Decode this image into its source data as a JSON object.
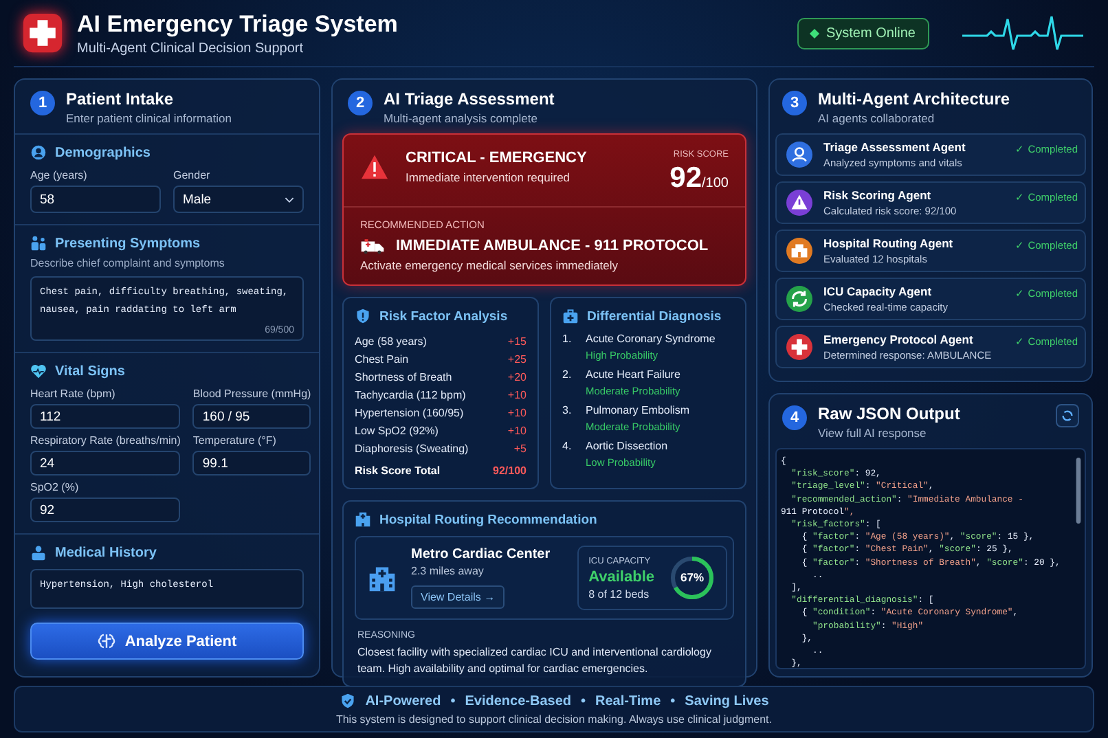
{
  "header": {
    "title": "AI Emergency Triage System",
    "subtitle": "Multi-Agent Clinical Decision Support",
    "status": "System Online"
  },
  "intake": {
    "number": "1",
    "title": "Patient Intake",
    "subtitle": "Enter patient clinical information",
    "demographics": {
      "title": "Demographics",
      "age_label": "Age (years)",
      "age": "58",
      "gender_label": "Gender",
      "gender": "Male"
    },
    "symptoms": {
      "title": "Presenting Symptoms",
      "hint": "Describe chief complaint and symptoms",
      "text": "Chest pain, difficulty breathing, sweating, nausea, pain raddating to left arm",
      "counter": "69/500"
    },
    "vitals": {
      "title": "Vital Signs",
      "fields": [
        {
          "label": "Heart Rate (bpm)",
          "value": "112"
        },
        {
          "label": "Blood Pressure (mmHg)",
          "value": "160 / 95"
        },
        {
          "label": "Respiratory Rate (breaths/min)",
          "value": "24"
        },
        {
          "label": "Temperature (°F)",
          "value": "99.1"
        },
        {
          "label": "SpO2 (%)",
          "value": "92"
        }
      ]
    },
    "history": {
      "title": "Medical History",
      "text": "Hypertension, High cholesterol"
    },
    "button": "Analyze Patient"
  },
  "assessment": {
    "number": "2",
    "title": "AI Triage Assessment",
    "subtitle": "Multi-agent analysis complete",
    "level": "CRITICAL - EMERGENCY",
    "level_note": "Immediate intervention required",
    "risk_label": "RISK SCORE",
    "risk_score": "92",
    "risk_max": "/100",
    "action_label": "RECOMMENDED ACTION",
    "action": "IMMEDIATE AMBULANCE - 911 PROTOCOL",
    "action_note": "Activate emergency medical services immediately",
    "risk_factors": {
      "title": "Risk Factor Analysis",
      "rows": [
        {
          "factor": "Age (58 years)",
          "score": "+15"
        },
        {
          "factor": "Chest Pain",
          "score": "+25"
        },
        {
          "factor": "Shortness of Breath",
          "score": "+20"
        },
        {
          "factor": "Tachycardia (112 bpm)",
          "score": "+10"
        },
        {
          "factor": "Hypertension (160/95)",
          "score": "+10"
        },
        {
          "factor": "Low SpO2 (92%)",
          "score": "+10"
        },
        {
          "factor": "Diaphoresis (Sweating)",
          "score": "+5"
        }
      ],
      "total_label": "Risk Score Total",
      "total": "92/100"
    },
    "diagnosis": {
      "title": "Differential Diagnosis",
      "items": [
        {
          "number": "1.",
          "condition": "Acute Coronary Syndrome",
          "probability": "High Probability"
        },
        {
          "number": "2.",
          "condition": "Acute Heart Failure",
          "probability": "Moderate Probability"
        },
        {
          "number": "3.",
          "condition": "Pulmonary Embolism",
          "probability": "Moderate Probability"
        },
        {
          "number": "4.",
          "condition": "Aortic Dissection",
          "probability": "Low Probability"
        }
      ]
    },
    "routing": {
      "title": "Hospital Routing Recommendation",
      "hospital": "Metro Cardiac Center",
      "distance": "2.3 miles away",
      "details_button": "View Details →",
      "icu_label": "ICU CAPACITY",
      "icu_status": "Available",
      "beds": "8 of 12 beds",
      "level": 0.67,
      "percent": "67%",
      "reasoning_label": "REASONING",
      "reasoning": "Closest facility with specialized cardiac ICU and interventional cardiology team. High availability and optimal for cardiac emergencies."
    }
  },
  "agents": {
    "number": "3",
    "title": "Multi-Agent Architecture",
    "subtitle": "AI agents collaborated",
    "items": [
      {
        "kind": "triage",
        "name": "Triage Assessment Agent",
        "detail": "Analyzed symptoms and vitals",
        "status": "✓ Completed",
        "color": "#2f6fe0"
      },
      {
        "kind": "risk",
        "name": "Risk Scoring Agent",
        "detail": "Calculated risk score: 92/100",
        "status": "✓ Completed",
        "color": "#7a3fd6"
      },
      {
        "kind": "hospital",
        "name": "Hospital Routing Agent",
        "detail": "Evaluated 12 hospitals",
        "status": "✓ Completed",
        "color": "#e07a22"
      },
      {
        "kind": "icu",
        "name": "ICU Capacity Agent",
        "detail": "Checked real-time capacity",
        "status": "✓ Completed",
        "color": "#25a24a"
      },
      {
        "kind": "protocol",
        "name": "Emergency Protocol Agent",
        "detail": "Determined response: AMBULANCE",
        "status": "✓ Completed",
        "color": "#d8323a"
      }
    ]
  },
  "raw": {
    "number": "4",
    "title": "Raw JSON Output",
    "subtitle": "View full AI response",
    "lines": [
      "{",
      "  \"risk_score\": 92,",
      "  \"triage_level\": \"Critical\",",
      "  \"recommended_action\": \"Immediate Ambulance -",
      "911 Protocol\",",
      "  \"risk_factors\": [",
      "    { \"factor\": \"Age (58 years)\", \"score\": 15 },",
      "    { \"factor\": \"Chest Pain\", \"score\": 25 },",
      "    { \"factor\": \"Shortness of Breath\", \"score\": 20 },",
      "      ..",
      "  ],",
      "  \"differential_diagnosis\": [",
      "    { \"condition\": \"Acute Coronary Syndrome\",",
      "      \"probability\": \"High\"",
      "    },",
      "      ..",
      "  },"
    ]
  },
  "footer": {
    "tags": [
      "AI-Powered",
      "Evidence-Based",
      "Real-Time",
      "Saving Lives"
    ],
    "separator": "•",
    "note": "This system is designed to support clinical decision making. Always use clinical judgment."
  }
}
